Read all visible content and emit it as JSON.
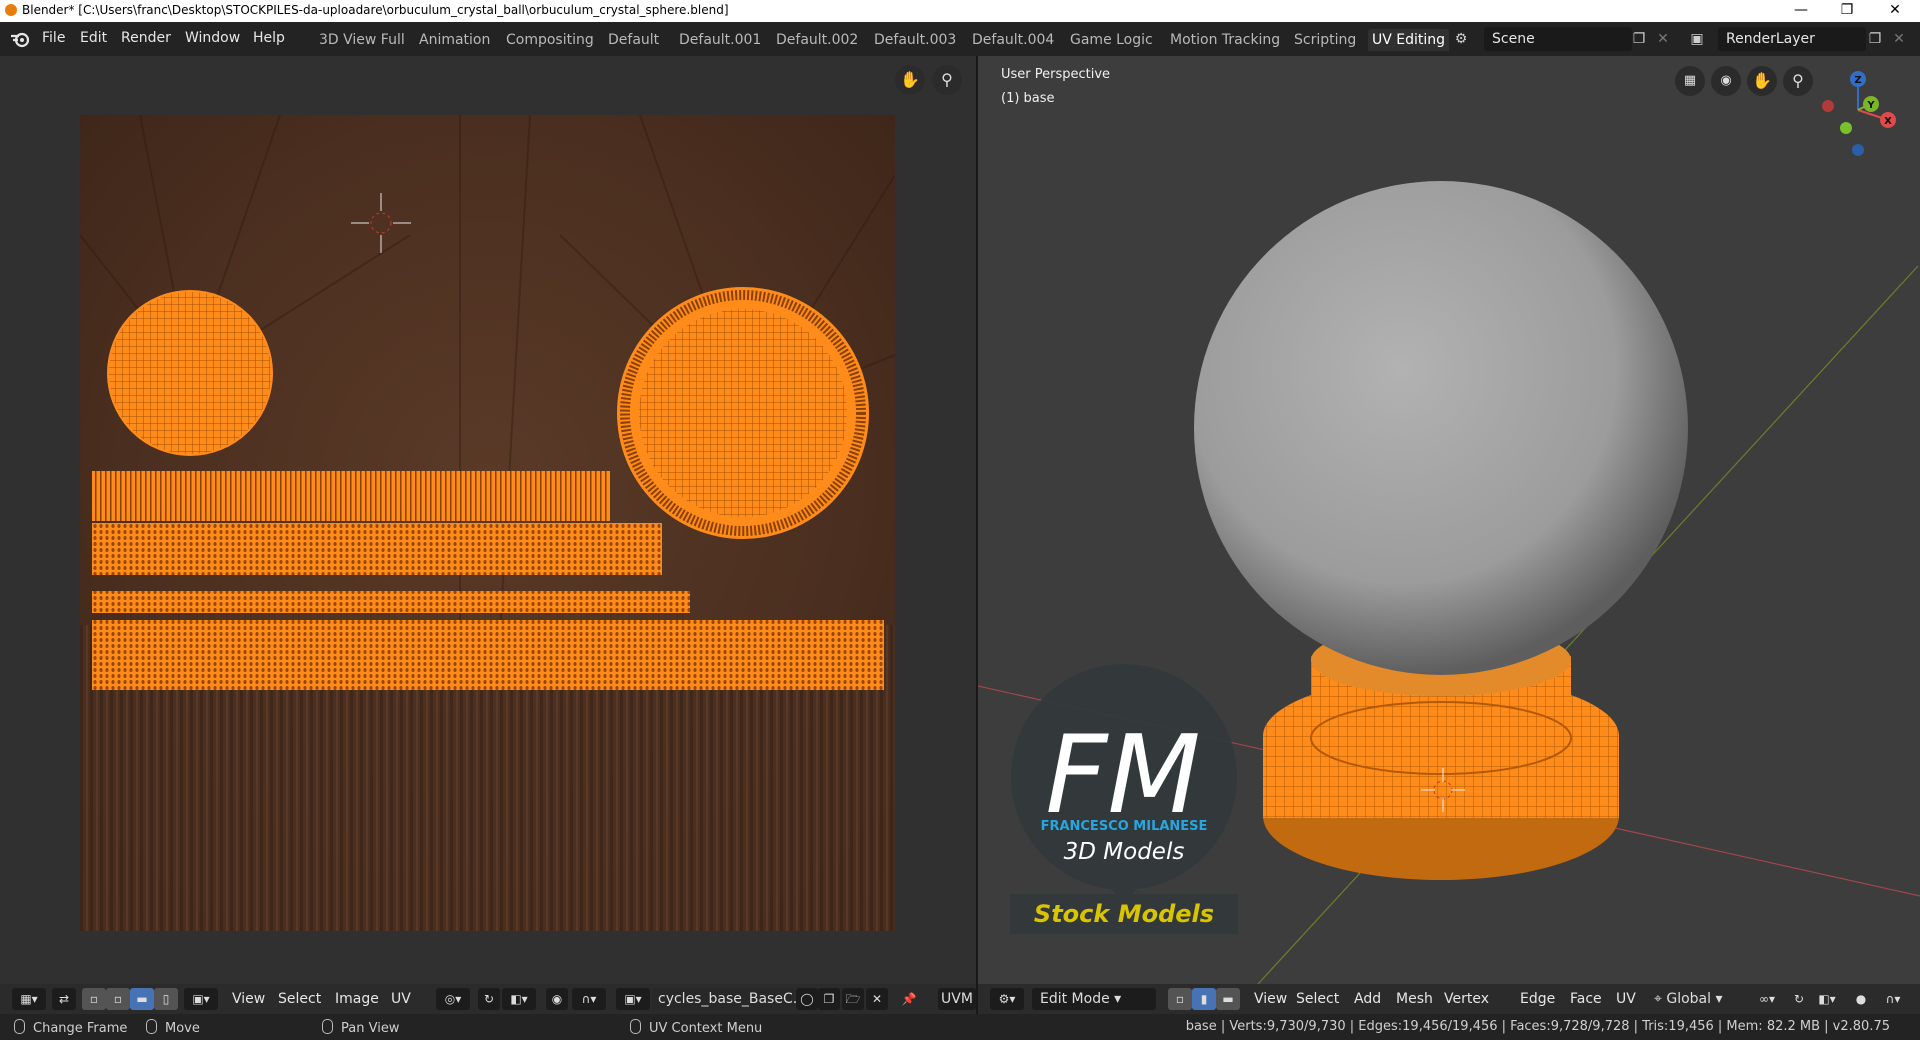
{
  "window": {
    "title": "Blender* [C:\\Users\\franc\\Desktop\\STOCKPILES-da-uploadare\\orbuculum_crystal_ball\\orbuculum_crystal_sphere.blend]",
    "min": "—",
    "restore": "❐",
    "close": "✕"
  },
  "menu": [
    "File",
    "Edit",
    "Render",
    "Window",
    "Help"
  ],
  "workspaces": [
    "3D View Full",
    "Animation",
    "Compositing",
    "Default",
    "Default.001",
    "Default.002",
    "Default.003",
    "Default.004",
    "Game Logic",
    "Motion Tracking",
    "Scripting",
    "UV Editing"
  ],
  "active_workspace": "UV Editing",
  "scene": "Scene",
  "render_layer": "RenderLayer",
  "uv_editor": {
    "menus": [
      "View",
      "Select",
      "Image",
      "UV"
    ],
    "image_name": "cycles_base_BaseC...",
    "uvmap": "UVM"
  },
  "viewport": {
    "perspective": "User Perspective",
    "object": "(1) base",
    "mode": "Edit Mode",
    "menus": [
      "View",
      "Select",
      "Add",
      "Mesh",
      "Vertex",
      "Edge",
      "Face",
      "UV"
    ],
    "orientation": "Global",
    "gizmo_axes": {
      "z": "Z",
      "y": "Y",
      "x": "X"
    }
  },
  "watermark": {
    "mark": "FM",
    "line1": "FRANCESCO MILANESE",
    "line2": "3D Models",
    "banner": "Stock Models"
  },
  "status": {
    "left": [
      "Change Frame",
      "Move",
      "Pan View",
      "UV Context Menu"
    ],
    "stats": "base | Verts:9,730/9,730 | Edges:19,456/19,456 | Faces:9,728/9,728 | Tris:19,456 | Mem: 82.2 MB | v2.80.75"
  },
  "colors": {
    "accent": "#4772b3",
    "uv": "#ff8c1a",
    "orange": "#e87d0d"
  }
}
